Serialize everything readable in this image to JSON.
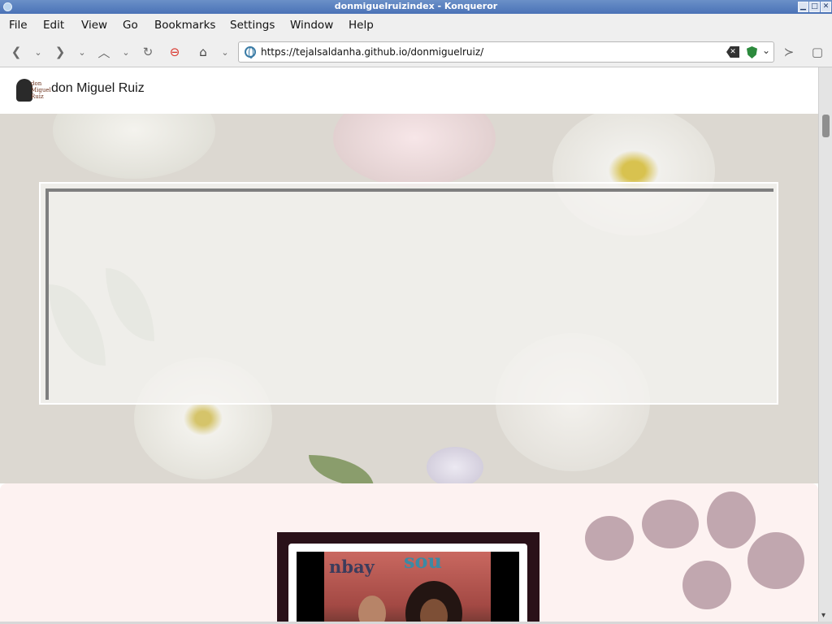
{
  "window": {
    "title": "donmiguelruizindex - Konqueror"
  },
  "menubar": {
    "items": [
      "File",
      "Edit",
      "View",
      "Go",
      "Bookmarks",
      "Settings",
      "Window",
      "Help"
    ]
  },
  "toolbar": {
    "url": "https://tejalsaldanha.github.io/donmiguelruiz/"
  },
  "site": {
    "title": "don Miguel Ruiz",
    "logo_text_1": "don",
    "logo_text_2": "Miguel",
    "logo_text_3": "Ruiz"
  },
  "photo": {
    "magazine_word_1": "nbay",
    "magazine_word_2": "sou"
  }
}
